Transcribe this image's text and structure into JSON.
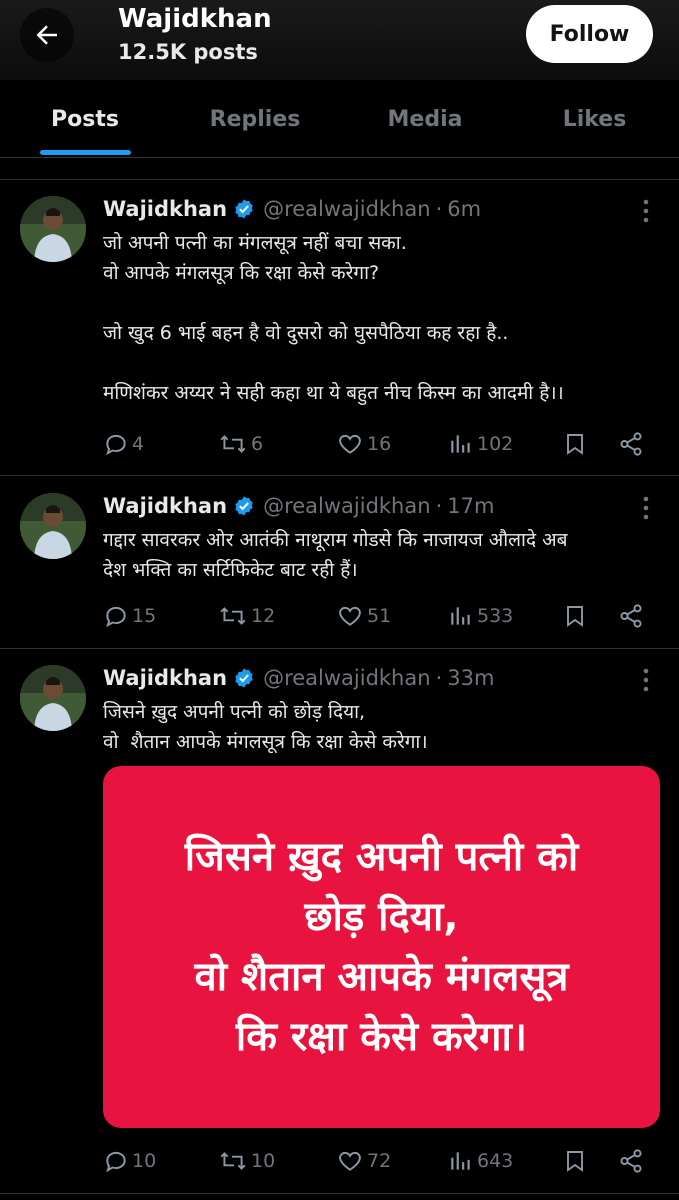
{
  "header": {
    "name": "Wajidkhan",
    "posts_count": "12.5K posts",
    "follow_label": "Follow"
  },
  "tabs": [
    {
      "label": "Posts",
      "active": true
    },
    {
      "label": "Replies",
      "active": false
    },
    {
      "label": "Media",
      "active": false
    },
    {
      "label": "Likes",
      "active": false
    }
  ],
  "colors": {
    "accent": "#1d9bf0",
    "media_bg": "#e8143f",
    "muted": "#71767b"
  },
  "tweets": [
    {
      "name": "Wajidkhan",
      "handle": "@realwajidkhan",
      "separator": "·",
      "time": "6m",
      "lines": [
        "जो अपनी पत्नी का मंगलसूत्र नहीं बचा सका.",
        "वो आपके मंगलसूत्र कि रक्षा केसे करेगा?",
        " ",
        "जो खुद 6 भाई बहन है वो दुसरो को घुसपैठिया कह रहा है..",
        " ",
        "मणिशंकर अय्यर ने सही कहा था ये बहुत नीच किस्म का आदमी है।।"
      ],
      "replies": "4",
      "reposts": "6",
      "likes": "16",
      "views": "102"
    },
    {
      "name": "Wajidkhan",
      "handle": "@realwajidkhan",
      "separator": "·",
      "time": "17m",
      "lines": [
        "गद्दार सावरकर ओर आतंकी नाथूराम गोडसे कि नाजायज औलादे अब",
        "देश भक्ति का सर्टिफिकेट बाट रही हैं।"
      ],
      "replies": "15",
      "reposts": "12",
      "likes": "51",
      "views": "533"
    },
    {
      "name": "Wajidkhan",
      "handle": "@realwajidkhan",
      "separator": "·",
      "time": "33m",
      "lines": [
        "जिसने ख़ुद अपनी पत्नी को छोड़ दिया,",
        "वो  शैतान आपके मंगलसूत्र कि रक्षा केसे करेगा।"
      ],
      "media_text": [
        "जिसने ख़ुद अपनी पत्नी को",
        "छोड़ दिया,",
        "वो  शैतान आपके मंगलसूत्र",
        "कि रक्षा केसे करेगा।"
      ],
      "replies": "10",
      "reposts": "10",
      "likes": "72",
      "views": "643"
    }
  ],
  "icons": {
    "back": "arrow-left-icon",
    "verified": "verified-badge-icon",
    "more": "more-vertical-icon",
    "reply": "reply-icon",
    "repost": "repost-icon",
    "like": "heart-icon",
    "views": "views-icon",
    "bookmark": "bookmark-icon",
    "share": "share-icon"
  }
}
